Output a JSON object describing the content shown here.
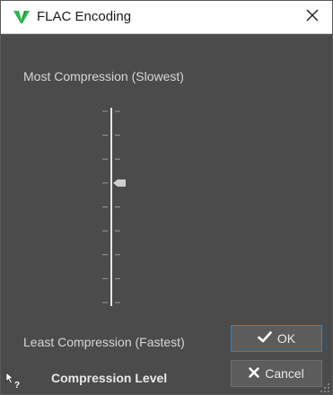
{
  "window": {
    "title": "FLAC Encoding",
    "icon": "wavelab-logo-icon",
    "close_icon": "close-icon"
  },
  "slider": {
    "top_label": "Most Compression (Slowest)",
    "bottom_label": "Least Compression (Fastest)",
    "steps": 9,
    "selected_step_from_top": 3
  },
  "buttons": {
    "ok_label": "OK",
    "cancel_label": "Cancel"
  },
  "footer": {
    "label": "Compression Level",
    "help_icon": "whats-this-help-icon"
  },
  "colors": {
    "body_bg": "#4b4b4b",
    "accent": "#1e88d8",
    "logo": "#2db84f"
  }
}
